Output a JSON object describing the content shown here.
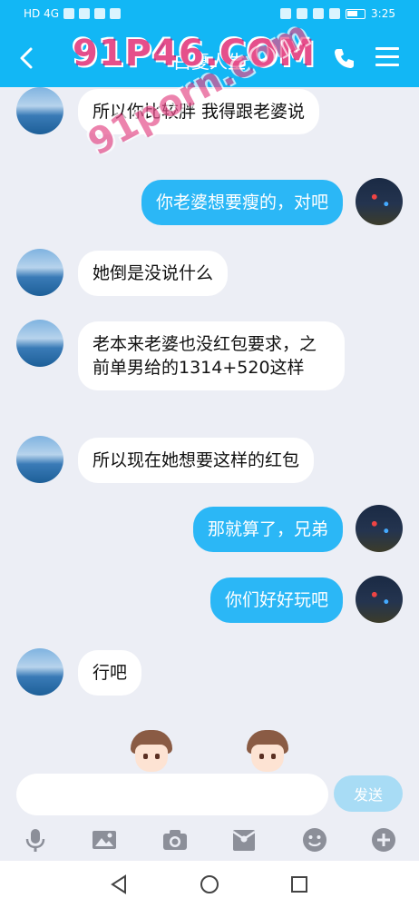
{
  "status_bar": {
    "left": "HD 4G",
    "time": "3:25"
  },
  "header": {
    "title": "白夏人生",
    "back_icon": "back-arrow-icon",
    "call_icon": "phone-icon",
    "menu_icon": "menu-icon"
  },
  "watermark": {
    "primary": "91P46.COM",
    "secondary": "91porn.com"
  },
  "messages": [
    {
      "side": "in",
      "text": "所以你比较胖  我得跟老婆说"
    },
    {
      "side": "out",
      "text": "你老婆想要瘦的，对吧"
    },
    {
      "side": "in",
      "text": "她倒是没说什么"
    },
    {
      "side": "in",
      "text": "老本来老婆也没红包要求，之前单男给的1314+520这样"
    },
    {
      "side": "in",
      "text": "所以现在她想要这样的红包"
    },
    {
      "side": "out",
      "text": "那就算了，兄弟"
    },
    {
      "side": "out",
      "text": "你们好好玩吧"
    },
    {
      "side": "in",
      "text": "行吧"
    }
  ],
  "input": {
    "placeholder": "",
    "send_label": "发送"
  },
  "toolbar": [
    "microphone-icon",
    "image-icon",
    "camera-icon",
    "red-packet-icon",
    "emoji-icon",
    "plus-icon"
  ],
  "colors": {
    "header": "#12b7f5",
    "out_bubble": "#2bb7f6",
    "background": "#eceef5",
    "send_disabled": "#a8dcf5"
  }
}
